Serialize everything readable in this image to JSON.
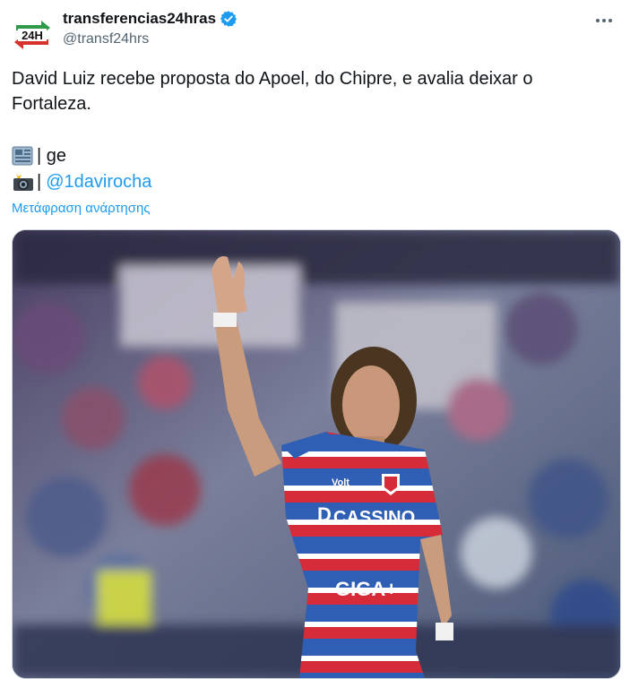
{
  "user": {
    "display_name": "transferencias24hras",
    "handle": "@transf24hrs",
    "avatar_text": "24H",
    "verified": true
  },
  "tweet": {
    "text_line1": "David Luiz recebe proposta do Apoel, do Chipre, e avalia deixar o",
    "text_line2": "Fortaleza.",
    "source_sep": "| ge",
    "photo_sep": "|",
    "photo_mention": "@1davirocha",
    "translate_label": "Μετάφραση ανάρτησης"
  },
  "media": {
    "shirt_sponsor": "CASSINO",
    "shirt_sponsor_prefix": "D",
    "shirt_brand": "Volt",
    "shirt_lower_sponsor": "GIGA+",
    "alt": "David Luiz waving in Fortaleza shirt"
  },
  "colors": {
    "accent": "#1d9bf0",
    "secondary_text": "#536471",
    "shirt_red": "#d62b38",
    "shirt_blue": "#2f5fb5"
  },
  "icons": {
    "more": "more-icon",
    "verified": "verified-badge-icon",
    "newspaper": "newspaper-icon",
    "camera": "camera-flash-icon"
  }
}
